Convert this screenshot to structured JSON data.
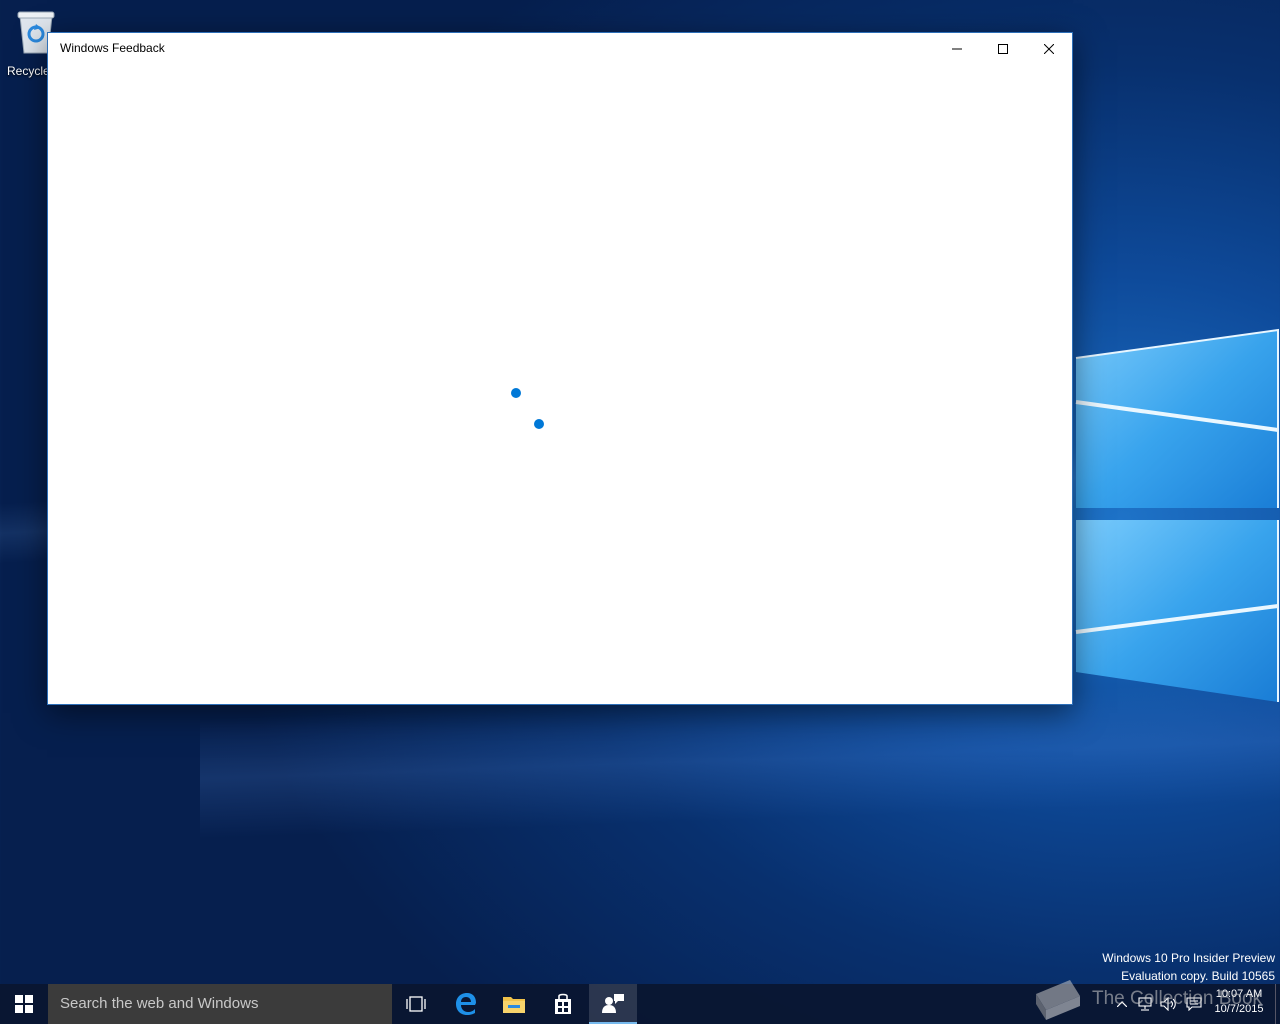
{
  "desktop": {
    "recycle_bin_label": "Recycle Bin",
    "watermark_line1": "Windows 10 Pro Insider Preview",
    "watermark_line2": "Evaluation copy. Build 10565"
  },
  "window": {
    "title": "Windows Feedback",
    "loading": true
  },
  "taskbar": {
    "search_placeholder": "Search the web and Windows",
    "apps": [
      "task-view",
      "edge",
      "file-explorer",
      "store",
      "windows-feedback"
    ],
    "active_app": "windows-feedback"
  },
  "tray": {
    "time": "10:07 AM",
    "date": "10/7/2015"
  },
  "overlay": {
    "watermark_text": "The Collection Book"
  },
  "colors": {
    "accent": "#0078d7",
    "taskbar": "#0a1630",
    "search_box": "#3b3b3b"
  }
}
